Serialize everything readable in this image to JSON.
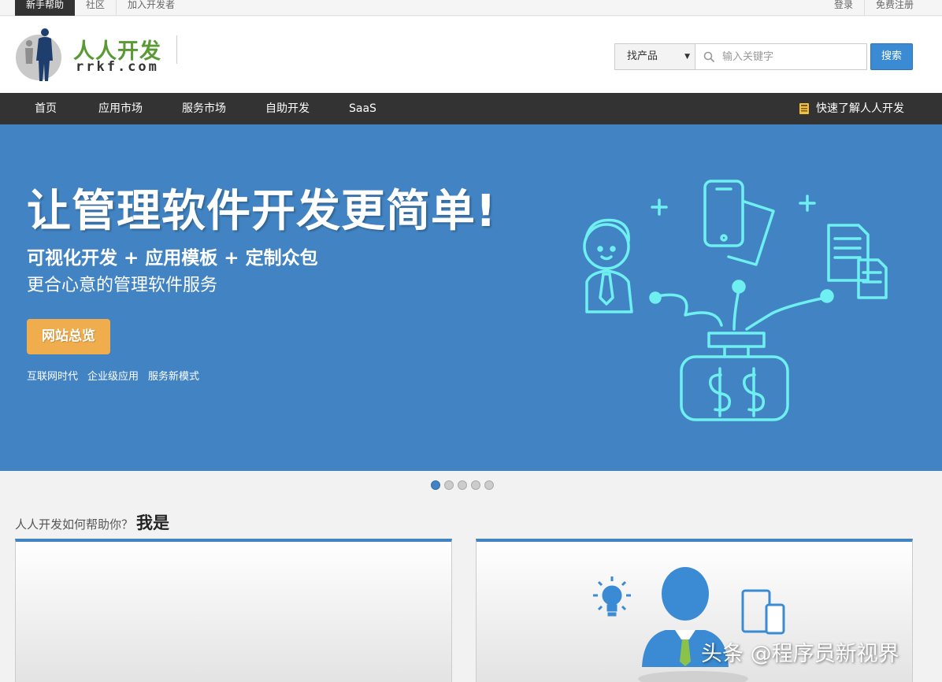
{
  "topbar": {
    "left": [
      "新手帮助",
      "社区",
      "加入开发者"
    ],
    "right": [
      "登录",
      "免费注册"
    ]
  },
  "header": {
    "brand": "人人开发",
    "brand_sub": "rrkf.com",
    "search": {
      "category": "找产品",
      "placeholder": "输入关键字",
      "button": "搜索"
    }
  },
  "nav": {
    "items": [
      "首页",
      "应用市场",
      "服务市场",
      "自助开发",
      "SaaS"
    ],
    "quick": "快速了解人人开发"
  },
  "hero": {
    "title": "让管理软件开发更简单!",
    "line1": "可视化开发 + 应用模板 + 定制众包",
    "line2": "更合心意的管理软件服务",
    "cta": "网站总览",
    "tags": [
      "互联网时代",
      "企业级应用",
      "服务新模式"
    ],
    "accent_color": "#4284c3"
  },
  "carousel": {
    "count": 5,
    "active": 1
  },
  "section": {
    "question": "人人开发如何帮助你？",
    "title": "我是"
  },
  "watermark": "头条 @程序员新视界"
}
